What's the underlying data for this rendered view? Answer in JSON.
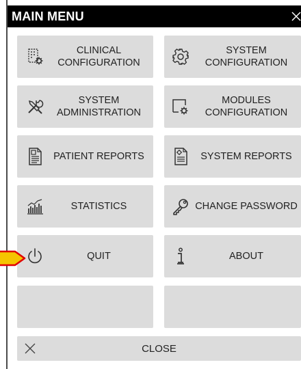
{
  "window": {
    "title": "MAIN MENU"
  },
  "menu": {
    "clinical_configuration": {
      "label": "CLINICAL\nCONFIGURATION",
      "icon": "clinical-config-icon"
    },
    "system_configuration": {
      "label": "SYSTEM\nCONFIGURATION",
      "icon": "gear-icon"
    },
    "system_administration": {
      "label": "SYSTEM\nADMINISTRATION",
      "icon": "tools-icon"
    },
    "modules_configuration": {
      "label": "MODULES\nCONFIGURATION",
      "icon": "module-gear-icon"
    },
    "patient_reports": {
      "label": "PATIENT REPORTS",
      "icon": "report-icon"
    },
    "system_reports": {
      "label": "SYSTEM REPORTS",
      "icon": "report-gear-icon"
    },
    "statistics": {
      "label": "STATISTICS",
      "icon": "chart-icon"
    },
    "change_password": {
      "label": "CHANGE PASSWORD",
      "icon": "key-icon"
    },
    "quit": {
      "label": "QUIT",
      "icon": "power-icon"
    },
    "about": {
      "label": "ABOUT",
      "icon": "info-icon"
    }
  },
  "close": {
    "label": "CLOSE",
    "icon": "close-icon"
  },
  "colors": {
    "tile": "#dcdcdc",
    "title_bar": "#000000",
    "pointer": "#f5c400",
    "pointer_border": "#e00000"
  }
}
